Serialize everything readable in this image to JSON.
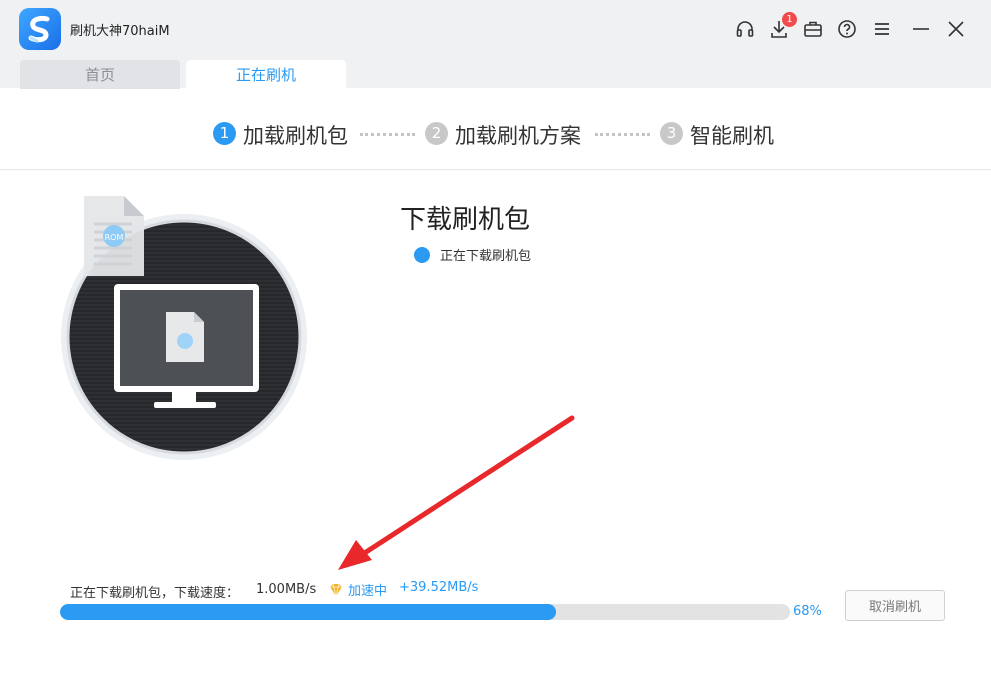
{
  "app": {
    "title": "刷机大神70haiM"
  },
  "titlebar": {
    "icons": [
      "headset-icon",
      "download-icon",
      "toolbox-icon",
      "help-icon",
      "menu-icon",
      "minimize-icon",
      "close-icon"
    ],
    "download_badge": "1"
  },
  "tabs": [
    {
      "label": "首页",
      "active": false
    },
    {
      "label": "正在刷机",
      "active": true
    }
  ],
  "steps": [
    {
      "number": "1",
      "label": "加载刷机包",
      "active": true
    },
    {
      "number": "2",
      "label": "加载刷机方案",
      "active": false
    },
    {
      "number": "3",
      "label": "智能刷机",
      "active": false
    }
  ],
  "main": {
    "title": "下载刷机包",
    "status": "正在下载刷机包",
    "illustration_badge": "ROM"
  },
  "progress": {
    "downloading_text": "正在下载刷机包，下载速度：",
    "speed": "1.00MB/s",
    "accel_label": "加速中",
    "accel_speed": "+39.52MB/s",
    "percent_value": 68,
    "percent_label": "68%",
    "cancel_label": "取消刷机"
  },
  "colors": {
    "accent": "#2a9af3",
    "step_inactive": "#c8c8c8",
    "arrow": "#e8282a",
    "vip": "#f0b429"
  }
}
